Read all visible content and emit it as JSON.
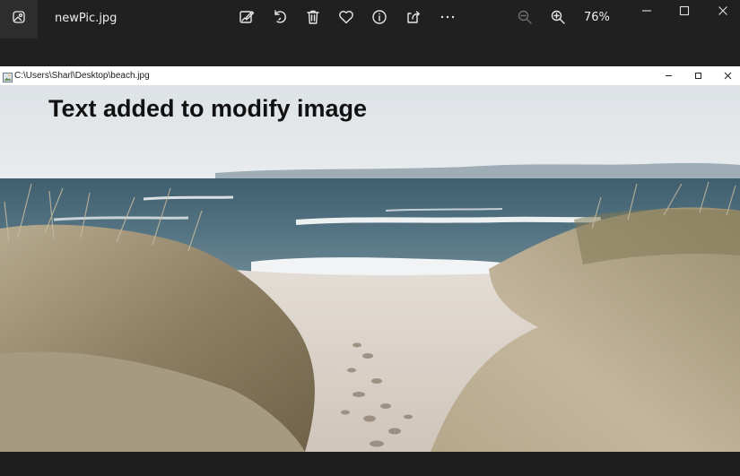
{
  "photos_app": {
    "file_name": "newPic.jpg",
    "zoom_level": "76%",
    "toolbar": [
      {
        "name": "edit-image-button",
        "icon": "edit-image-icon"
      },
      {
        "name": "rotate-button",
        "icon": "rotate-icon"
      },
      {
        "name": "delete-button",
        "icon": "trash-icon"
      },
      {
        "name": "favorite-button",
        "icon": "heart-icon"
      },
      {
        "name": "info-button",
        "icon": "info-icon"
      },
      {
        "name": "share-button",
        "icon": "share-icon"
      },
      {
        "name": "more-button",
        "icon": "more-icon"
      },
      {
        "name": "zoom-out-button",
        "icon": "zoom-out-icon",
        "disabled": true
      },
      {
        "name": "zoom-in-button",
        "icon": "zoom-in-icon"
      }
    ]
  },
  "viewer_window": {
    "path": "C:\\Users\\Sharl\\Desktop\\beach.jpg",
    "overlay_text": "Text added to modify image"
  },
  "colors": {
    "app_background": "#202020",
    "sky": "#e3e7ea",
    "sea": "#4d6a78",
    "foam": "#f2f4f5",
    "sand": "#d6cfc6",
    "grass": "#a99a7c"
  }
}
